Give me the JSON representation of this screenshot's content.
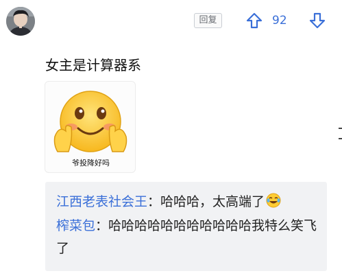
{
  "comment": {
    "author_avatar": "user-avatar",
    "reply_label": "回复",
    "vote_count": "92",
    "upvote_icon": "upvote-arrow-icon",
    "downvote_icon": "downvote-arrow-icon",
    "text": "女主是计算器系",
    "sticker": {
      "icon": "shy-smiley-sticker",
      "caption": "爷投降好吗"
    }
  },
  "sub_replies": [
    {
      "username": "江西老表社会王",
      "separator": "：",
      "text": "哈哈哈，太高端了",
      "emoji": "laughing-crying-emoji"
    },
    {
      "username": "榨菜包",
      "separator": "：",
      "text": "哈哈哈哈哈哈哈哈哈哈哈我特么笑飞了"
    }
  ],
  "colors": {
    "accent_blue": "#3a6fd8",
    "reply_bg": "#f1f2f4",
    "text_dark": "#111111"
  }
}
